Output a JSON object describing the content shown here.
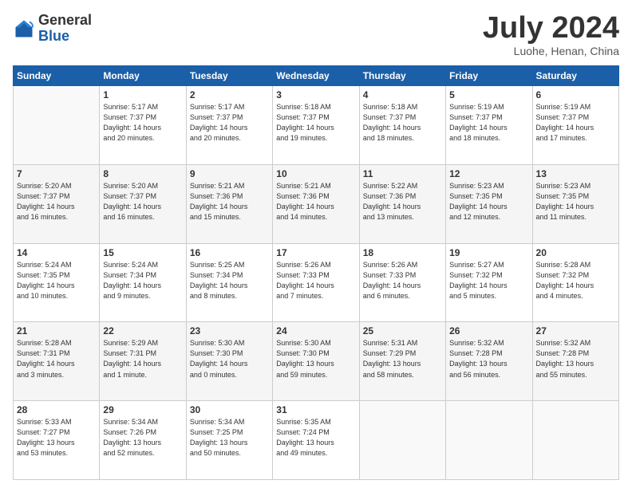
{
  "header": {
    "logo_general": "General",
    "logo_blue": "Blue",
    "month_title": "July 2024",
    "location": "Luohe, Henan, China"
  },
  "days_of_week": [
    "Sunday",
    "Monday",
    "Tuesday",
    "Wednesday",
    "Thursday",
    "Friday",
    "Saturday"
  ],
  "weeks": [
    [
      {
        "day": "",
        "detail": ""
      },
      {
        "day": "1",
        "detail": "Sunrise: 5:17 AM\nSunset: 7:37 PM\nDaylight: 14 hours\nand 20 minutes."
      },
      {
        "day": "2",
        "detail": "Sunrise: 5:17 AM\nSunset: 7:37 PM\nDaylight: 14 hours\nand 20 minutes."
      },
      {
        "day": "3",
        "detail": "Sunrise: 5:18 AM\nSunset: 7:37 PM\nDaylight: 14 hours\nand 19 minutes."
      },
      {
        "day": "4",
        "detail": "Sunrise: 5:18 AM\nSunset: 7:37 PM\nDaylight: 14 hours\nand 18 minutes."
      },
      {
        "day": "5",
        "detail": "Sunrise: 5:19 AM\nSunset: 7:37 PM\nDaylight: 14 hours\nand 18 minutes."
      },
      {
        "day": "6",
        "detail": "Sunrise: 5:19 AM\nSunset: 7:37 PM\nDaylight: 14 hours\nand 17 minutes."
      }
    ],
    [
      {
        "day": "7",
        "detail": "Sunrise: 5:20 AM\nSunset: 7:37 PM\nDaylight: 14 hours\nand 16 minutes."
      },
      {
        "day": "8",
        "detail": "Sunrise: 5:20 AM\nSunset: 7:37 PM\nDaylight: 14 hours\nand 16 minutes."
      },
      {
        "day": "9",
        "detail": "Sunrise: 5:21 AM\nSunset: 7:36 PM\nDaylight: 14 hours\nand 15 minutes."
      },
      {
        "day": "10",
        "detail": "Sunrise: 5:21 AM\nSunset: 7:36 PM\nDaylight: 14 hours\nand 14 minutes."
      },
      {
        "day": "11",
        "detail": "Sunrise: 5:22 AM\nSunset: 7:36 PM\nDaylight: 14 hours\nand 13 minutes."
      },
      {
        "day": "12",
        "detail": "Sunrise: 5:23 AM\nSunset: 7:35 PM\nDaylight: 14 hours\nand 12 minutes."
      },
      {
        "day": "13",
        "detail": "Sunrise: 5:23 AM\nSunset: 7:35 PM\nDaylight: 14 hours\nand 11 minutes."
      }
    ],
    [
      {
        "day": "14",
        "detail": "Sunrise: 5:24 AM\nSunset: 7:35 PM\nDaylight: 14 hours\nand 10 minutes."
      },
      {
        "day": "15",
        "detail": "Sunrise: 5:24 AM\nSunset: 7:34 PM\nDaylight: 14 hours\nand 9 minutes."
      },
      {
        "day": "16",
        "detail": "Sunrise: 5:25 AM\nSunset: 7:34 PM\nDaylight: 14 hours\nand 8 minutes."
      },
      {
        "day": "17",
        "detail": "Sunrise: 5:26 AM\nSunset: 7:33 PM\nDaylight: 14 hours\nand 7 minutes."
      },
      {
        "day": "18",
        "detail": "Sunrise: 5:26 AM\nSunset: 7:33 PM\nDaylight: 14 hours\nand 6 minutes."
      },
      {
        "day": "19",
        "detail": "Sunrise: 5:27 AM\nSunset: 7:32 PM\nDaylight: 14 hours\nand 5 minutes."
      },
      {
        "day": "20",
        "detail": "Sunrise: 5:28 AM\nSunset: 7:32 PM\nDaylight: 14 hours\nand 4 minutes."
      }
    ],
    [
      {
        "day": "21",
        "detail": "Sunrise: 5:28 AM\nSunset: 7:31 PM\nDaylight: 14 hours\nand 3 minutes."
      },
      {
        "day": "22",
        "detail": "Sunrise: 5:29 AM\nSunset: 7:31 PM\nDaylight: 14 hours\nand 1 minute."
      },
      {
        "day": "23",
        "detail": "Sunrise: 5:30 AM\nSunset: 7:30 PM\nDaylight: 14 hours\nand 0 minutes."
      },
      {
        "day": "24",
        "detail": "Sunrise: 5:30 AM\nSunset: 7:30 PM\nDaylight: 13 hours\nand 59 minutes."
      },
      {
        "day": "25",
        "detail": "Sunrise: 5:31 AM\nSunset: 7:29 PM\nDaylight: 13 hours\nand 58 minutes."
      },
      {
        "day": "26",
        "detail": "Sunrise: 5:32 AM\nSunset: 7:28 PM\nDaylight: 13 hours\nand 56 minutes."
      },
      {
        "day": "27",
        "detail": "Sunrise: 5:32 AM\nSunset: 7:28 PM\nDaylight: 13 hours\nand 55 minutes."
      }
    ],
    [
      {
        "day": "28",
        "detail": "Sunrise: 5:33 AM\nSunset: 7:27 PM\nDaylight: 13 hours\nand 53 minutes."
      },
      {
        "day": "29",
        "detail": "Sunrise: 5:34 AM\nSunset: 7:26 PM\nDaylight: 13 hours\nand 52 minutes."
      },
      {
        "day": "30",
        "detail": "Sunrise: 5:34 AM\nSunset: 7:25 PM\nDaylight: 13 hours\nand 50 minutes."
      },
      {
        "day": "31",
        "detail": "Sunrise: 5:35 AM\nSunset: 7:24 PM\nDaylight: 13 hours\nand 49 minutes."
      },
      {
        "day": "",
        "detail": ""
      },
      {
        "day": "",
        "detail": ""
      },
      {
        "day": "",
        "detail": ""
      }
    ]
  ]
}
